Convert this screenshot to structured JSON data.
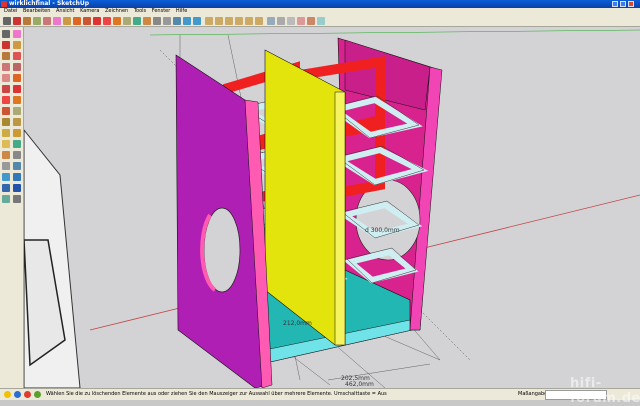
{
  "window": {
    "title": "wirklichfinal - SketchUp"
  },
  "menu": [
    "Datei",
    "Bearbeiten",
    "Ansicht",
    "Kamera",
    "Zeichnen",
    "Tools",
    "Fenster",
    "Hilfe"
  ],
  "toolbar_tools": [
    "select-tool-icon",
    "pencil-icon",
    "rectangle-icon",
    "circle-icon",
    "arc-icon",
    "eraser-icon",
    "paint-bucket-icon",
    "push-pull-icon",
    "offset-icon",
    "move-icon",
    "rotate-icon",
    "scale-icon",
    "tape-measure-icon",
    "orbit-icon",
    "pan-icon",
    "zoom-icon",
    "zoom-window-icon",
    "zoom-extents-icon",
    "previous-view-icon",
    "next-view-icon",
    "iso-view-icon",
    "top-view-icon",
    "front-view-icon",
    "right-view-icon",
    "back-view-icon",
    "left-view-icon",
    "xray-icon",
    "wireframe-icon",
    "hidden-line-icon",
    "shaded-icon",
    "textured-icon",
    "monochrome-icon"
  ],
  "sidebar_tools": [
    "select-tool-icon",
    "eraser-icon",
    "pencil-icon",
    "paint-bucket-icon",
    "rectangle-icon",
    "circle-icon",
    "arc-icon",
    "polygon-icon",
    "freehand-icon",
    "push-pull-icon",
    "follow-me-icon",
    "move-icon",
    "rotate-icon",
    "scale-icon",
    "offset-icon",
    "tape-measure-icon",
    "dimension-icon",
    "protractor-icon",
    "text-icon",
    "axes-icon",
    "3d-text-icon",
    "orbit-icon",
    "pan-icon",
    "zoom-icon",
    "zoom-window-icon",
    "zoom-extents-icon",
    "previous-view-icon",
    "walk-icon",
    "look-around-icon",
    "position-camera-icon",
    "section-plane-icon",
    "footprint-icon"
  ],
  "dimensions": {
    "d_300": "d 300,0mm",
    "d_212": "212,0mm",
    "d_202": "202,5mm",
    "d_462": "462,0mm"
  },
  "status": {
    "hint": "Wählen Sie die zu löschenden Elemente aus oder ziehen Sie den Mauszeiger zur Auswahl über mehrere Elemente. Umschalttaste = Aus",
    "measure_label": "Maßangaben",
    "measure_value": ""
  },
  "watermark": "hifi-forum.de",
  "colors": {
    "panel_magenta": "#b01fb3",
    "panel_pink": "#ec3aa7",
    "frame_red": "#f02020",
    "divider_yellow": "#e3e40c",
    "shelf_lightblue": "#cfeef2",
    "floor_cyan": "#23b7b3",
    "hotpink_edge": "#ff5bb3"
  }
}
